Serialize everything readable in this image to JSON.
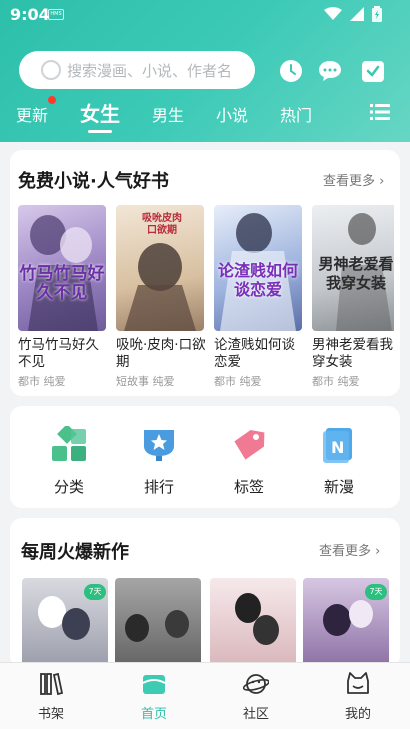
{
  "status": {
    "time": "9:04",
    "sim_label": "HMS"
  },
  "search": {
    "placeholder": "搜索漫画、小说、作者名"
  },
  "header_icons": [
    "clock-icon",
    "message-icon",
    "checkin-icon"
  ],
  "tabs": [
    {
      "label": "更新",
      "has_dot": true
    },
    {
      "label": "女生",
      "active": true
    },
    {
      "label": "男生"
    },
    {
      "label": "小说"
    },
    {
      "label": "热门"
    }
  ],
  "free_novels": {
    "title": "免费小说·人气好书",
    "see_more": "查看更多",
    "books": [
      {
        "title": "竹马竹马好久不见",
        "tags": "都市 纯爱",
        "cover_text": "竹马竹马好久不见",
        "cover_color": "#a58bc7"
      },
      {
        "title": "吸吮·皮肉·口欲期",
        "tags": "短故事 纯爱",
        "cover_text": "吸吮皮肉口欲期",
        "cover_color": "#c7b08f"
      },
      {
        "title": "论渣贱如何谈恋爱",
        "tags": "都市 纯爱",
        "cover_text": "论渣贱如何谈恋爱",
        "cover_color": "#8fa6d6"
      },
      {
        "title": "男神老爱看我穿女装",
        "tags": "都市 纯爱",
        "cover_text": "男神老爱看我穿女装",
        "cover_color": "#b7bcc2"
      }
    ]
  },
  "quick_links": [
    {
      "label": "分类",
      "icon": "category-icon"
    },
    {
      "label": "排行",
      "icon": "ranking-icon"
    },
    {
      "label": "标签",
      "icon": "tag-icon"
    },
    {
      "label": "新漫",
      "icon": "new-comic-icon"
    }
  ],
  "weekly_hits": {
    "title": "每周火爆新作",
    "see_more": "查看更多",
    "badge": "7天"
  },
  "bottom_nav": [
    {
      "label": "书架",
      "icon": "bookshelf-icon"
    },
    {
      "label": "首页",
      "icon": "home-icon",
      "active": true
    },
    {
      "label": "社区",
      "icon": "community-icon"
    },
    {
      "label": "我的",
      "icon": "profile-icon"
    }
  ],
  "colors": {
    "accent": "#2dbfa9",
    "red_dot": "#ff3b30"
  }
}
